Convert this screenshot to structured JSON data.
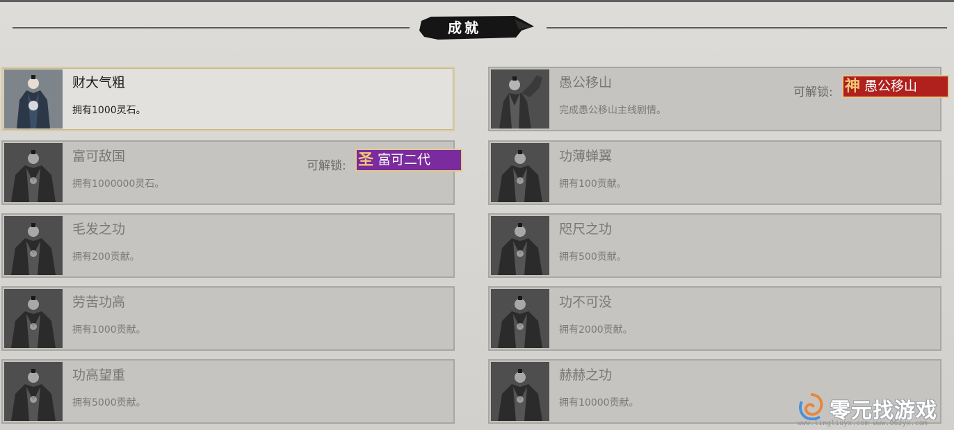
{
  "header": {
    "title": "成就"
  },
  "unlock_label": "可解锁:",
  "achievements": [
    {
      "title": "财大气粗",
      "desc": "拥有1000灵石。",
      "active": true
    },
    {
      "title": "愚公移山",
      "desc": "完成愚公移山主线剧情。",
      "unlock": {
        "glyph": "神",
        "name": "愚公移山",
        "color": "#b0201d"
      }
    },
    {
      "title": "富可敌国",
      "desc": "拥有1000000灵石。",
      "unlock": {
        "glyph": "圣",
        "name": "富可二代",
        "color": "#7a2c9e"
      }
    },
    {
      "title": "功薄蝉翼",
      "desc": "拥有100贡献。"
    },
    {
      "title": "毛发之功",
      "desc": "拥有200贡献。"
    },
    {
      "title": "咫尺之功",
      "desc": "拥有500贡献。"
    },
    {
      "title": "劳苦功高",
      "desc": "拥有1000贡献。"
    },
    {
      "title": "功不可没",
      "desc": "拥有2000贡献。"
    },
    {
      "title": "功高望重",
      "desc": "拥有5000贡献。"
    },
    {
      "title": "赫赫之功",
      "desc": "拥有10000贡献。"
    }
  ],
  "watermark": {
    "text": "零元找游戏",
    "url": "www.lingliuyx.com  www.06zyx.com"
  }
}
